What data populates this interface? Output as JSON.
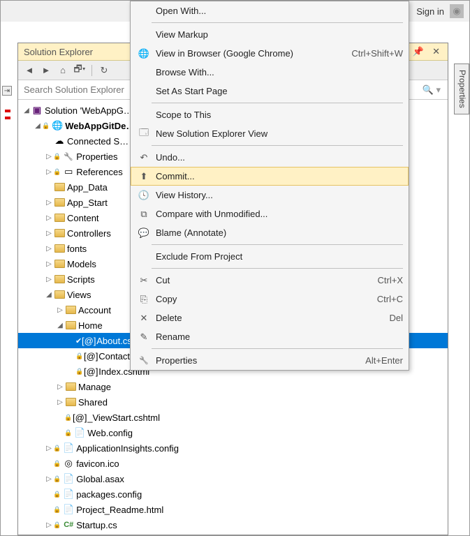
{
  "topbar": {
    "signin": "Sign in"
  },
  "panel": {
    "title": "Solution Explorer"
  },
  "search": {
    "placeholder": "Search Solution Explorer"
  },
  "sideTab": {
    "label": "Properties"
  },
  "tree": {
    "solution": "Solution 'WebAppG…",
    "project": "WebAppGitDe…",
    "connected": "Connected S…",
    "properties": "Properties",
    "references": "References",
    "appData": "App_Data",
    "appStart": "App_Start",
    "content": "Content",
    "controllers": "Controllers",
    "fonts": "fonts",
    "models": "Models",
    "scripts": "Scripts",
    "views": "Views",
    "account": "Account",
    "home": "Home",
    "about": "About.cshtml",
    "contact": "Contact.cshtml",
    "index": "Index.cshtml",
    "manage": "Manage",
    "shared": "Shared",
    "viewstart": "_ViewStart.cshtml",
    "webconfig": "Web.config",
    "appinsights": "ApplicationInsights.config",
    "favicon": "favicon.ico",
    "global": "Global.asax",
    "packages": "packages.config",
    "readme": "Project_Readme.html",
    "startup": "Startup.cs"
  },
  "menu": {
    "openWith": "Open With...",
    "viewMarkup": "View Markup",
    "viewBrowser": "View in Browser (Google Chrome)",
    "viewBrowserKey": "Ctrl+Shift+W",
    "browseWith": "Browse With...",
    "setStart": "Set As Start Page",
    "scope": "Scope to This",
    "newView": "New Solution Explorer View",
    "undo": "Undo...",
    "commit": "Commit...",
    "history": "View History...",
    "compare": "Compare with Unmodified...",
    "blame": "Blame (Annotate)",
    "exclude": "Exclude From Project",
    "cut": "Cut",
    "cutKey": "Ctrl+X",
    "copy": "Copy",
    "copyKey": "Ctrl+C",
    "delete": "Delete",
    "deleteKey": "Del",
    "rename": "Rename",
    "properties": "Properties",
    "propertiesKey": "Alt+Enter"
  }
}
